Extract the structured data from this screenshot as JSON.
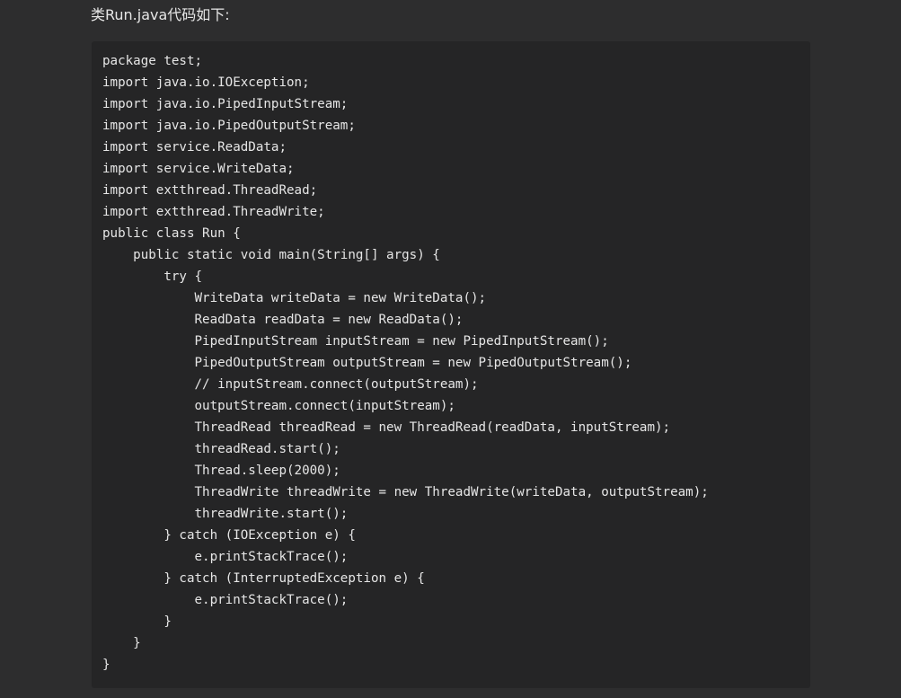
{
  "caption": "类Run.java代码如下:",
  "code_lines": [
    "package test;",
    "import java.io.IOException;",
    "import java.io.PipedInputStream;",
    "import java.io.PipedOutputStream;",
    "import service.ReadData;",
    "import service.WriteData;",
    "import extthread.ThreadRead;",
    "import extthread.ThreadWrite;",
    "public class Run {",
    "    public static void main(String[] args) {",
    "        try {",
    "            WriteData writeData = new WriteData();",
    "            ReadData readData = new ReadData();",
    "            PipedInputStream inputStream = new PipedInputStream();",
    "            PipedOutputStream outputStream = new PipedOutputStream();",
    "            // inputStream.connect(outputStream);",
    "            outputStream.connect(inputStream);",
    "            ThreadRead threadRead = new ThreadRead(readData, inputStream);",
    "            threadRead.start();",
    "            Thread.sleep(2000);",
    "            ThreadWrite threadWrite = new ThreadWrite(writeData, outputStream);",
    "            threadWrite.start();",
    "        } catch (IOException e) {",
    "            e.printStackTrace();",
    "        } catch (InterruptedException e) {",
    "            e.printStackTrace();",
    "        }",
    "    }",
    "}"
  ]
}
